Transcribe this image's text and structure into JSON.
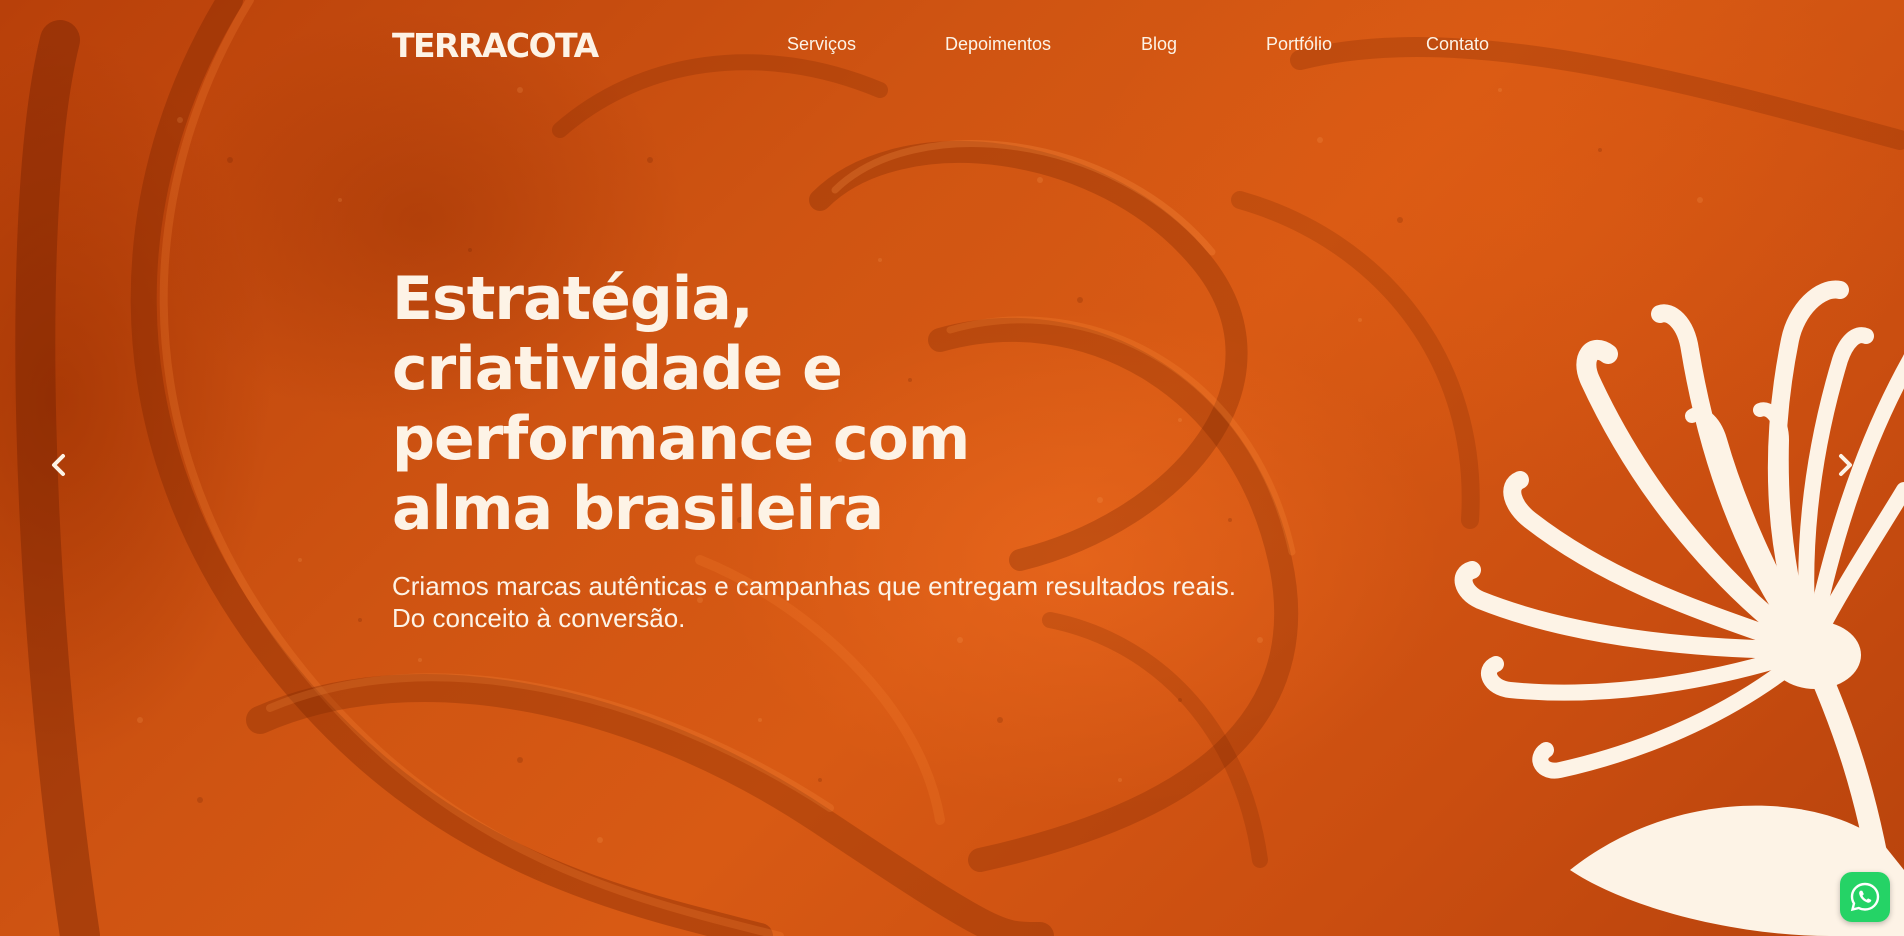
{
  "brand": {
    "logo_text": "TERRACOTA"
  },
  "nav": {
    "items": [
      {
        "label": "Serviços"
      },
      {
        "label": "Depoimentos"
      },
      {
        "label": "Blog"
      },
      {
        "label": "Portfólio"
      },
      {
        "label": "Contato"
      }
    ]
  },
  "hero": {
    "headline": "Estratégia, criatividade e performance com alma brasileira",
    "subtitle_line1": "Criamos marcas autênticas e campanhas que entregam resultados reais.",
    "subtitle_line2": "Do conceito à conversão."
  },
  "carousel": {
    "prev_icon": "chevron-left-icon",
    "next_icon": "chevron-right-icon"
  },
  "whatsapp": {
    "icon": "whatsapp-icon",
    "color": "#25d366"
  },
  "colors": {
    "background": "#cf5412",
    "text": "#fdf3e6",
    "flower": "#fdf3e6"
  }
}
